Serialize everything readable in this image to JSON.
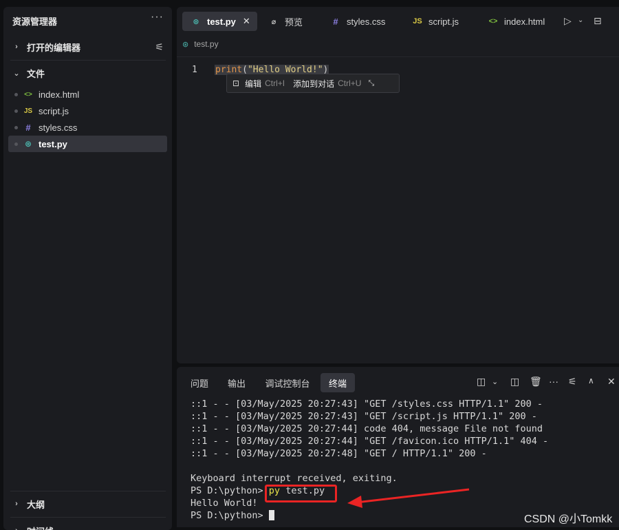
{
  "sidebar": {
    "title": "资源管理器",
    "more": "···",
    "open_editors": {
      "chevron": "›",
      "label": "打开的编辑器",
      "action": "⚟"
    },
    "files_section": {
      "chevron": "⌄",
      "label": "文件"
    },
    "files": [
      {
        "icon": "<>",
        "name": "index.html",
        "icon_color": "#7fbf3f"
      },
      {
        "icon": "JS",
        "name": "script.js",
        "icon_color": "#d9c845"
      },
      {
        "icon": "#",
        "name": "styles.css",
        "icon_color": "#8b7fe0"
      },
      {
        "icon": "⊛",
        "name": "test.py",
        "icon_color": "#4bb6ad"
      }
    ],
    "outline": {
      "chevron": "›",
      "label": "大纲"
    },
    "timeline": {
      "chevron": "›",
      "label": "时间线"
    }
  },
  "editor": {
    "tabs": [
      {
        "icon": "⊛",
        "label": "test.py",
        "close": "✕",
        "icon_color": "#4bb6ad"
      },
      {
        "icon": "⌀",
        "label": "预览",
        "icon_color": "#d4d4d4"
      },
      {
        "icon": "#",
        "label": "styles.css",
        "icon_color": "#8b7fe0"
      },
      {
        "icon": "JS",
        "label": "script.js",
        "icon_color": "#d9c845"
      },
      {
        "icon": "<>",
        "label": "index.html",
        "icon_color": "#7fbf3f"
      }
    ],
    "breadcrumb": {
      "icon": "⊛",
      "file": "test.py"
    },
    "line_number": "1",
    "code": {
      "keyword": "print",
      "open": "(",
      "string": "\"Hello World!\"",
      "close": ")"
    },
    "inline_menu": {
      "edit_label": "编辑",
      "edit_key": "Ctrl+I",
      "chat_label": "添加到对话",
      "chat_key": "Ctrl+U"
    }
  },
  "panel": {
    "tabs": [
      "问题",
      "输出",
      "调试控制台",
      "终端"
    ],
    "active_tab": "终端",
    "terminal_lines": [
      "::1 - - [03/May/2025 20:27:43] \"GET /styles.css HTTP/1.1\" 200 -",
      "::1 - - [03/May/2025 20:27:43] \"GET /script.js HTTP/1.1\" 200 -",
      "::1 - - [03/May/2025 20:27:44] code 404, message File not found",
      "::1 - - [03/May/2025 20:27:44] \"GET /favicon.ico HTTP/1.1\" 404 -",
      "::1 - - [03/May/2025 20:27:48] \"GET / HTTP/1.1\" 200 -",
      "",
      "Keyboard interrupt received, exiting."
    ],
    "prompt": "PS D:\\python> ",
    "command_exe": "py",
    "command_arg": " test.py",
    "output": "Hello World!",
    "prompt2": "PS D:\\python> "
  },
  "watermark": "CSDN @小Tomkk"
}
